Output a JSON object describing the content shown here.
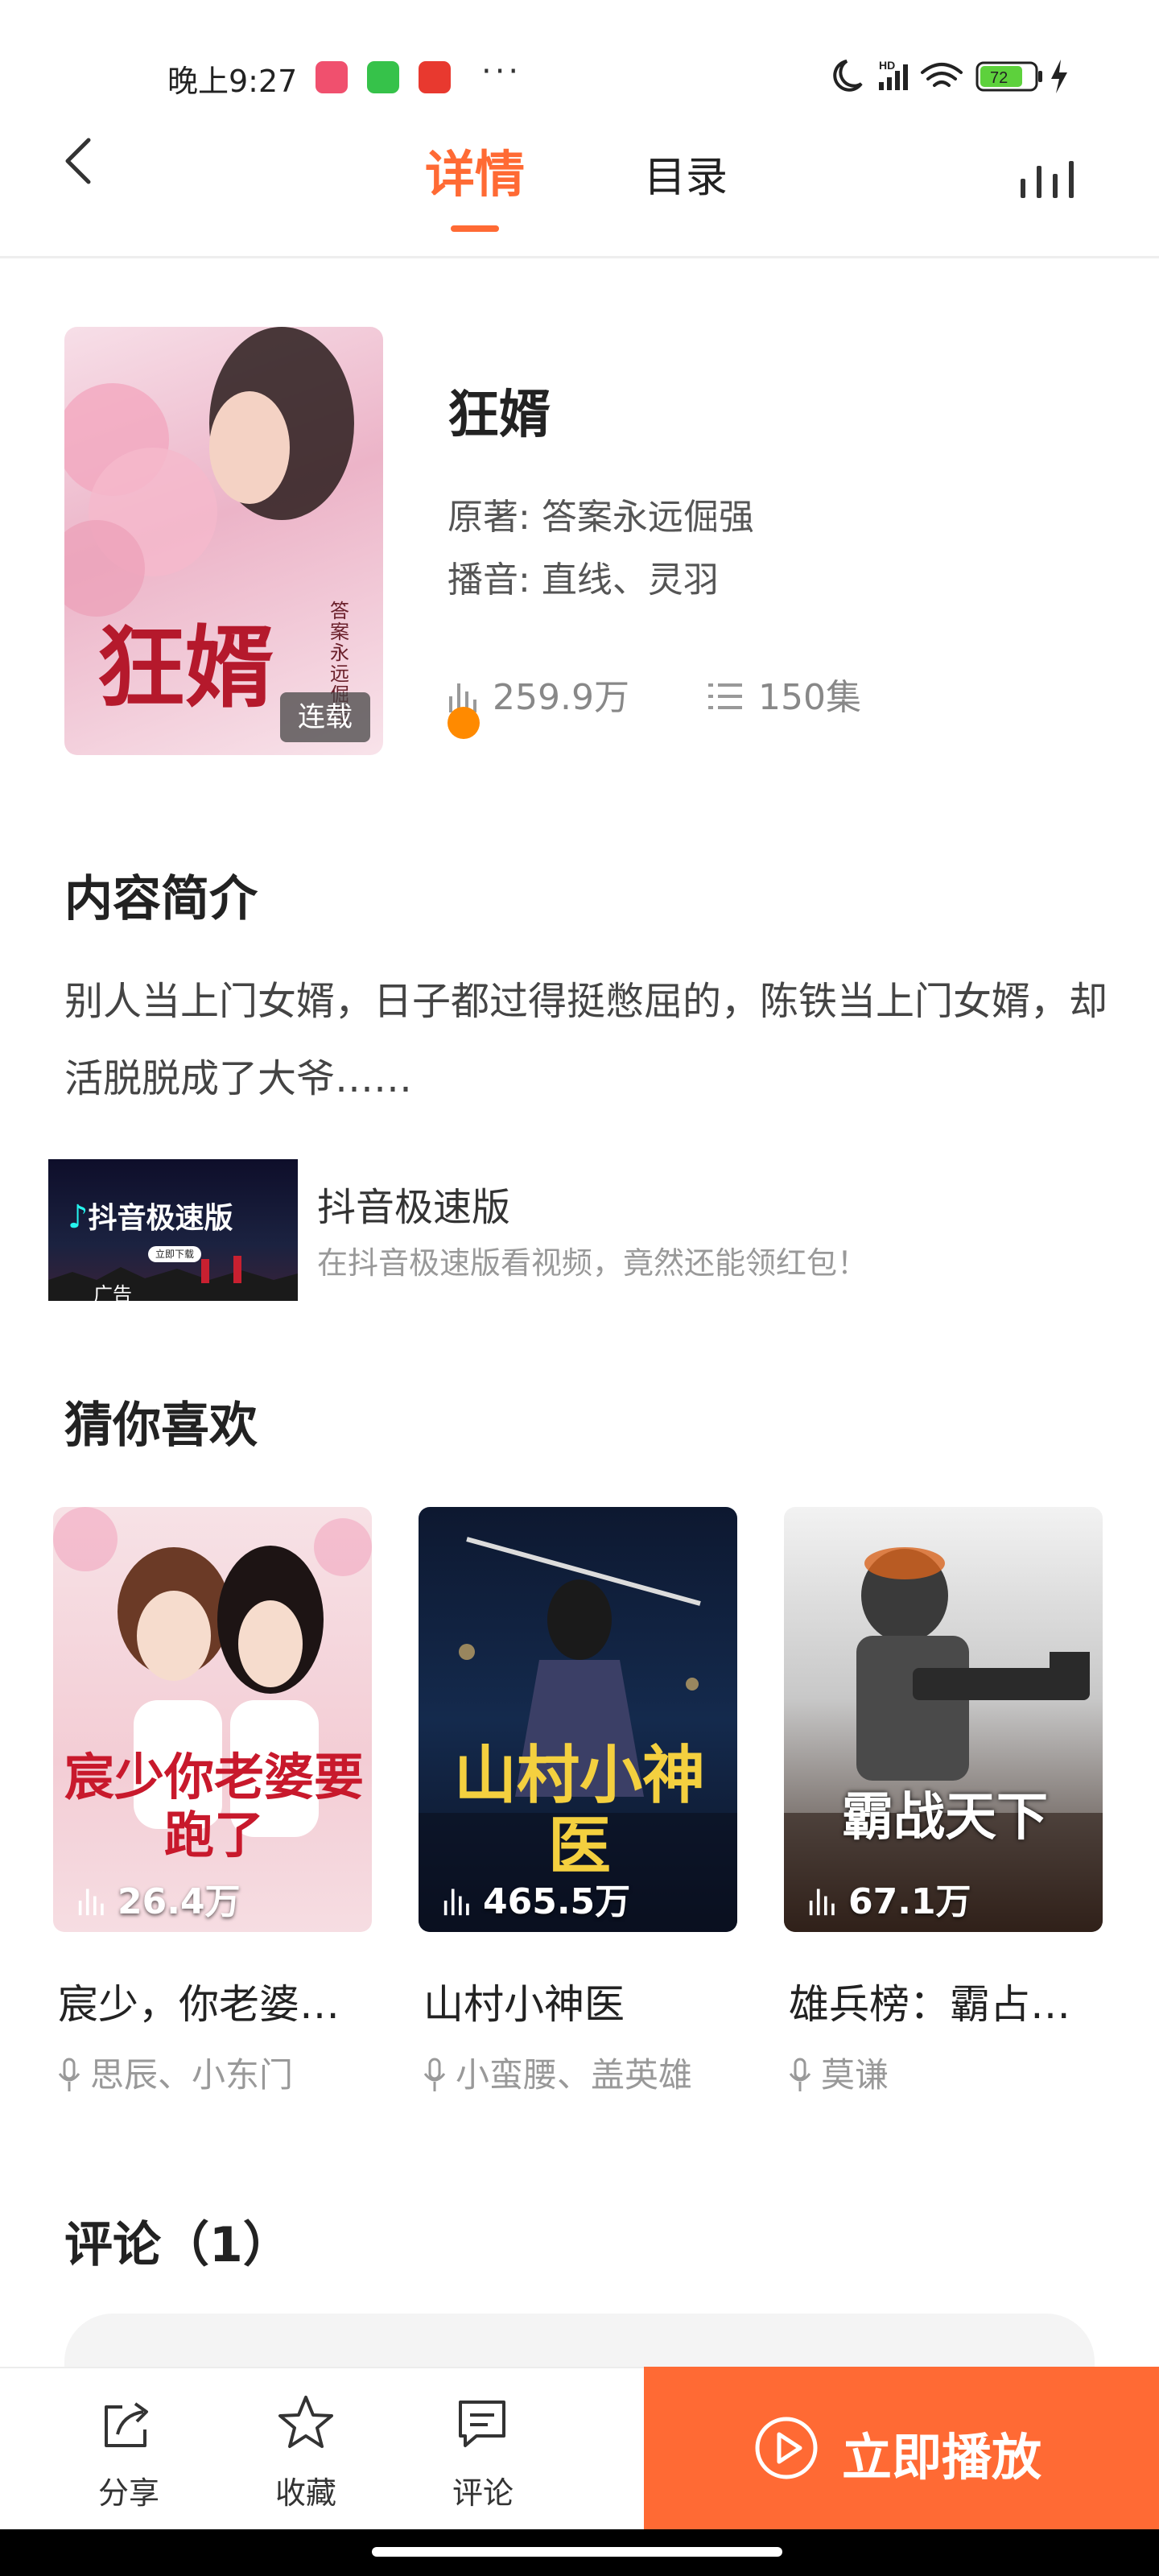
{
  "status_bar": {
    "time": "晚上9:27",
    "dots": "···",
    "battery": "72"
  },
  "header": {
    "tab_detail": "详情",
    "tab_catalog": "目录"
  },
  "book": {
    "title": "狂婿",
    "cover_title": "狂婿",
    "cover_author_vertical": "答案永远倔强",
    "cover_badge": "连载",
    "author_label": "原著:",
    "author": "答案永远倔强",
    "narrator_label": "播音:",
    "narrators": "直线、灵羽",
    "plays": "259.9万",
    "episodes": "150集"
  },
  "intro": {
    "title": "内容简介",
    "text": "别人当上门女婿，日子都过得挺憋屈的，陈铁当上门女婿，却活脱脱成了大爷……"
  },
  "ad": {
    "image_logo": "抖音极速版",
    "image_button": "立即下载",
    "image_label": "广告",
    "title": "抖音极速版",
    "desc": "在抖音极速版看视频，竟然还能领红包！"
  },
  "recommend": {
    "title": "猜你喜欢",
    "items": [
      {
        "title": "宸少，你老婆…",
        "narrators": "思辰、小东门",
        "plays": "26.4万",
        "cover_text": "宸少你老婆要跑了"
      },
      {
        "title": "山村小神医",
        "narrators": "小蛮腰、盖英雄",
        "plays": "465.5万",
        "cover_text": "山村小神医"
      },
      {
        "title": "雄兵榜：霸占…",
        "narrators": "莫谦",
        "plays": "67.1万",
        "cover_text": "霸战天下"
      }
    ]
  },
  "comments": {
    "title": "评论（1）"
  },
  "bottom_bar": {
    "share": "分享",
    "favorite": "收藏",
    "comment": "评论",
    "play": "立即播放"
  },
  "colors": {
    "accent": "#ff6a34",
    "text_primary": "#222222",
    "text_secondary": "#999999"
  }
}
